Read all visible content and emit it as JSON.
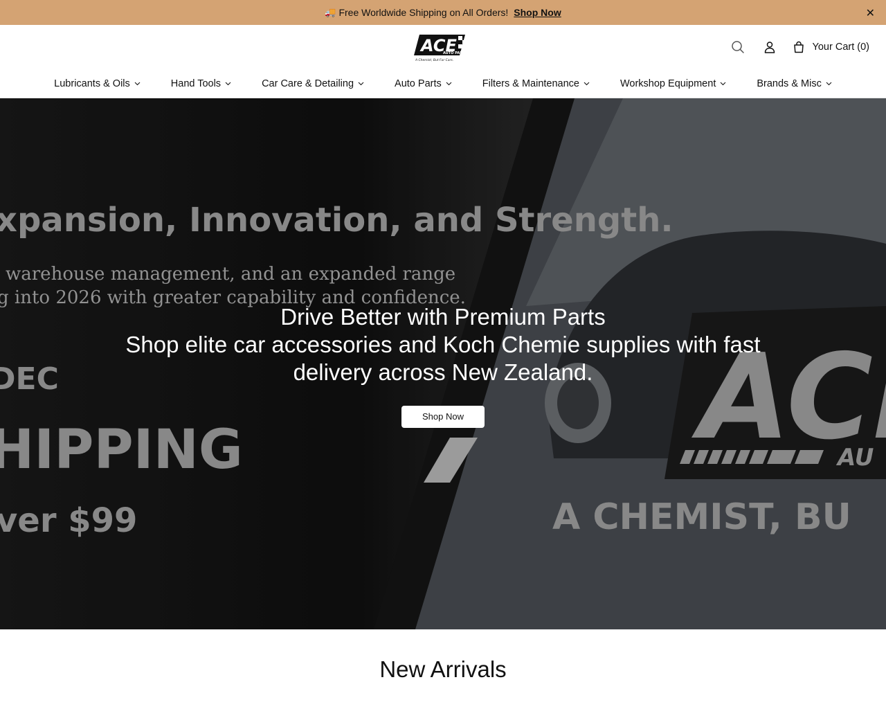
{
  "announcement": {
    "text": "Free Worldwide Shipping on All Orders!",
    "link_label": "Shop Now",
    "close_glyph": "✕",
    "bg_color": "#d4a373",
    "icon": "truck-icon"
  },
  "header": {
    "logo_text": "ACE",
    "logo_sub": "AUTO PARTS",
    "logo_tagline": "A Chemist, But For Cars.",
    "cart_label": "Your Cart (0)"
  },
  "nav": {
    "items": [
      {
        "label": "Lubricants & Oils"
      },
      {
        "label": "Hand Tools"
      },
      {
        "label": "Car Care & Detailing"
      },
      {
        "label": "Auto Parts"
      },
      {
        "label": "Filters & Maintenance"
      },
      {
        "label": "Workshop Equipment"
      },
      {
        "label": "Brands & Misc"
      }
    ]
  },
  "hero": {
    "title": "Drive Better with Premium Parts",
    "subtitle": "Shop elite car accessories and Koch Chemie supplies with fast delivery across New Zealand.",
    "button_label": "Shop Now",
    "background_text": {
      "headline": "xpansion, Innovation, and Strength.",
      "line1": "warehouse management, and an expanded range",
      "line2": "g into 2026 with greater capability and confidence.",
      "dec": "DEC",
      "shipping": "HIPPING",
      "over": "ver $99",
      "logo_big": "ACE",
      "logo_big_sub": "AU",
      "tagline": "A CHEMIST, BU"
    }
  },
  "sections": {
    "new_arrivals_title": "New Arrivals"
  }
}
